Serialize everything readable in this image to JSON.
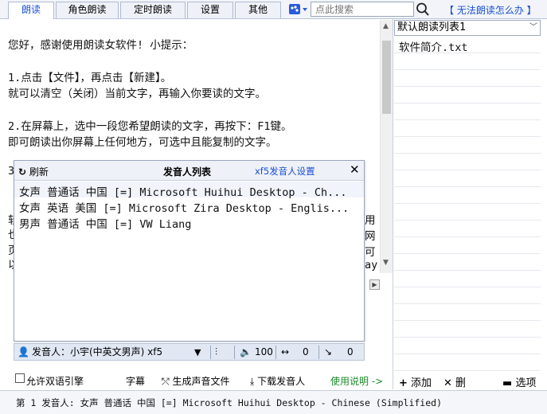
{
  "tabs": [
    {
      "label": "朗读",
      "active": true
    },
    {
      "label": "角色朗读",
      "active": false
    },
    {
      "label": "定时朗读",
      "active": false
    },
    {
      "label": "设置",
      "active": false
    },
    {
      "label": "其他",
      "active": false
    }
  ],
  "search": {
    "placeholder": "点此搜索",
    "icon": "search-icon"
  },
  "help_link": "【 无法朗读怎么办 】",
  "editor": {
    "lines": [
      "您好，感谢使用朗读女软件!   小提示：",
      "1.点击【文件】，再点击【新建】。",
      "  就可以清空（关闭）当前文字，再输入你要读的文字。",
      "2.在屏幕上，选中一段您希望朗读的文字，再按下：F1键。",
      "  即可朗读出你屏幕上任何地方，可选中且能复制的文字。",
      "3",
      "软",
      "也",
      "页",
      "以"
    ],
    "right_fragments": [
      "用",
      "网",
      "可",
      "ay"
    ]
  },
  "right_panel": {
    "list_name": "默认朗读列表1",
    "items": [
      "软件简介.txt"
    ],
    "add_label": "添加",
    "delete_label": "删",
    "options_label": "选项"
  },
  "popup": {
    "refresh_label": "刷新",
    "title": "发音人列表",
    "settings_link": "xf5发音人设置",
    "voices": [
      "女声 普通话 中国 [=] Microsoft Huihui Desktop - Ch...",
      "女声 英语 美国 [=] Microsoft Zira Desktop - Englis...",
      "男声 普通话 中国 [=] VW Liang"
    ]
  },
  "voice_bar": {
    "speaker_label": "发音人：",
    "speaker_value": "小宇(中英文男声) xf5",
    "volume": "100",
    "speed": "0",
    "pitch": "0"
  },
  "bottom_toolbar": {
    "allow_dual_engine": "允许双语引擎",
    "subtitles": "字幕",
    "generate_audio": "生成声音文件",
    "download_voices": "下载发音人",
    "usage_guide": "使用说明 ->"
  },
  "status": "第 1 发音人: 女声 普通话 中国 [=] Microsoft Huihui Desktop - Chinese (Simplified)",
  "colors": {
    "accent": "#1a4fd6",
    "link_green": "#1a8a2a",
    "bar_bg": "#e1e8f4"
  }
}
